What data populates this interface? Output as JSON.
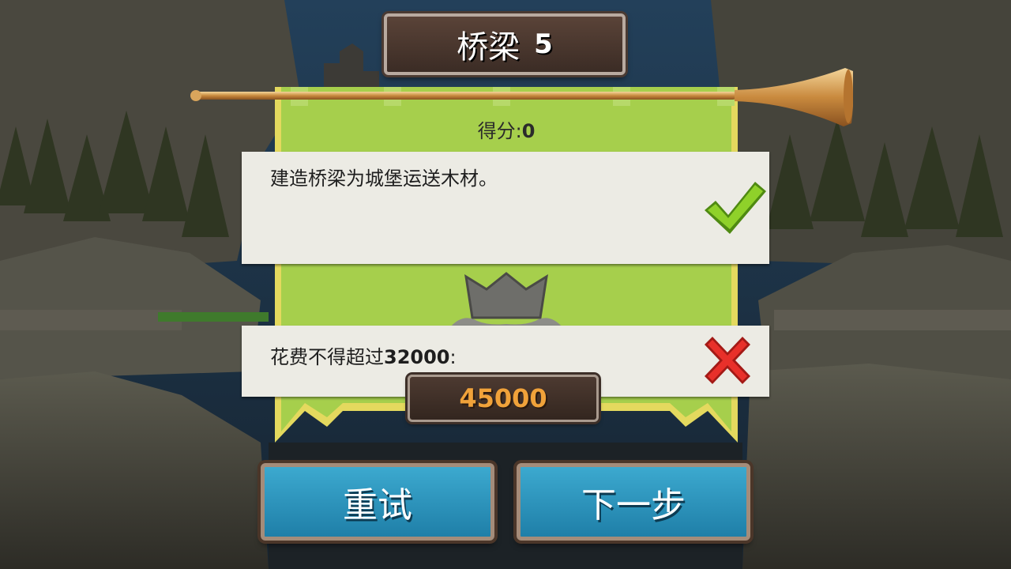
{
  "level": {
    "title": "桥梁",
    "number": "5"
  },
  "score": {
    "label": "得分:",
    "value": "0"
  },
  "objectives": [
    {
      "text": "建造桥梁为城堡运送木材。",
      "status": "complete",
      "icon": "checkmark-icon"
    },
    {
      "text_prefix": "花费不得超过",
      "limit": "32000",
      "text_suffix": ":",
      "status": "failed",
      "icon": "cross-icon",
      "actual_cost": "45000"
    }
  ],
  "buttons": {
    "retry": "重试",
    "next": "下一步"
  },
  "colors": {
    "banner": "#a6cf4c",
    "button": "#2f97c0",
    "cost_text": "#f0a23a",
    "check": "#7ac21e",
    "cross": "#e02a24"
  }
}
